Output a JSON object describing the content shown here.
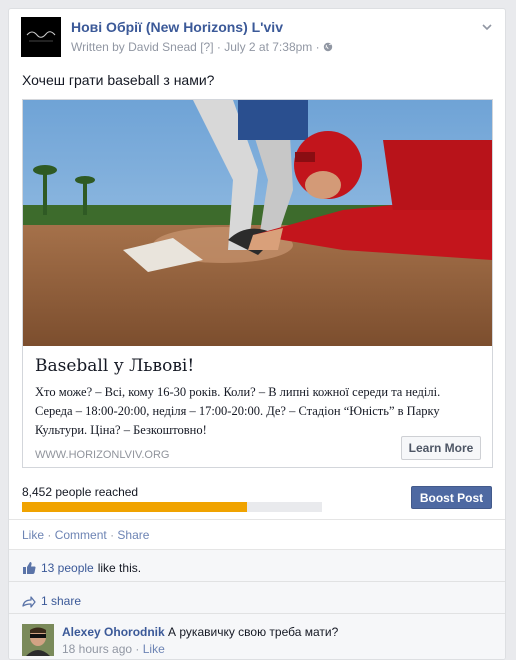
{
  "post": {
    "page_name": "Нові Обрії (New Horizons) L'viv",
    "byline_prefix": "Written by",
    "author": "David Snead",
    "help_marker": "[?]",
    "separator": "·",
    "date": "July 2 at 7:38pm",
    "text": "Хочеш грати baseball з нами?"
  },
  "link_card": {
    "title": "Baseball у Львові!",
    "description": "Хто може? – Всі, кому 16-30 років. Коли? – В липні кожної середи та неділі. Середа – 18:00-20:00, неділя – 17:00-20:00. Де? – Стадіон “Юність” в Парку Культури. Ціна? – Безкоштовно!",
    "domain": "WWW.HORIZONLVIV.ORG",
    "cta_label": "Learn More"
  },
  "insights": {
    "reach_label": "8,452 people reached",
    "reach_progress": 0.75,
    "boost_label": "Boost Post"
  },
  "actions": {
    "like": "Like",
    "comment": "Comment",
    "share": "Share",
    "dot": "·"
  },
  "ufi": {
    "likes_link": "13 people",
    "likes_suffix": "like this.",
    "shares": "1 share"
  },
  "comment": {
    "author": "Alexey Ohorodnik",
    "text": "А рукавичку свою треба мати?",
    "time": "18 hours ago",
    "like": "Like",
    "dot": "·"
  },
  "icons": {
    "thumb": "thumbs-up-icon",
    "share": "share-arrow-icon",
    "globe": "globe-icon",
    "chevron": "chevron-down-icon"
  },
  "colors": {
    "link_blue": "#3b5998",
    "boost_blue": "#4e69a2",
    "reach_orange": "#f0a300"
  }
}
